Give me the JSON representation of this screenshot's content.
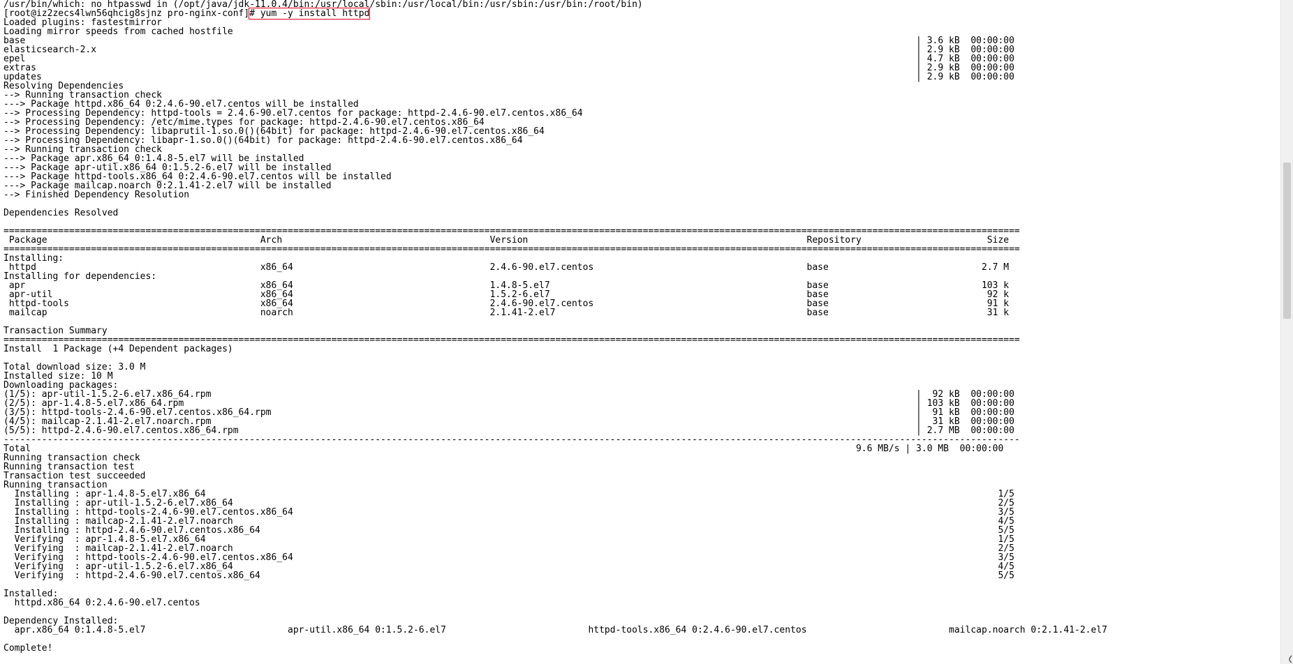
{
  "terminal": {
    "lines": [
      "/usr/bin/which: no htpasswd in (/opt/java/jdk-11.0.4/bin:/usr/local/sbin:/usr/local/bin:/usr/sbin:/usr/bin:/root/bin)",
      "[root@iz2zecs4lwn56qhcig8sjnz pro-nginx-conf]# yum -y install httpd",
      "Loaded plugins: fastestmirror",
      "Loading mirror speeds from cached hostfile",
      "base                                                                                                                                                                   | 3.6 kB  00:00:00",
      "elasticsearch-2.x                                                                                                                                                      | 2.9 kB  00:00:00",
      "epel                                                                                                                                                                   | 4.7 kB  00:00:00",
      "extras                                                                                                                                                                 | 2.9 kB  00:00:00",
      "updates                                                                                                                                                                | 2.9 kB  00:00:00",
      "Resolving Dependencies",
      "--> Running transaction check",
      "---> Package httpd.x86_64 0:2.4.6-90.el7.centos will be installed",
      "--> Processing Dependency: httpd-tools = 2.4.6-90.el7.centos for package: httpd-2.4.6-90.el7.centos.x86_64",
      "--> Processing Dependency: /etc/mime.types for package: httpd-2.4.6-90.el7.centos.x86_64",
      "--> Processing Dependency: libaprutil-1.so.0()(64bit) for package: httpd-2.4.6-90.el7.centos.x86_64",
      "--> Processing Dependency: libapr-1.so.0()(64bit) for package: httpd-2.4.6-90.el7.centos.x86_64",
      "--> Running transaction check",
      "---> Package apr.x86_64 0:1.4.8-5.el7 will be installed",
      "---> Package apr-util.x86_64 0:1.5.2-6.el7 will be installed",
      "---> Package httpd-tools.x86_64 0:2.4.6-90.el7.centos will be installed",
      "---> Package mailcap.noarch 0:2.1.41-2.el7 will be installed",
      "--> Finished Dependency Resolution",
      "",
      "Dependencies Resolved",
      "",
      "==========================================================================================================================================================================================",
      " Package                                       Arch                                      Version                                                   Repository                       Size",
      "==========================================================================================================================================================================================",
      "Installing:",
      " httpd                                         x86_64                                    2.4.6-90.el7.centos                                       base                            2.7 M",
      "Installing for dependencies:",
      " apr                                           x86_64                                    1.4.8-5.el7                                               base                            103 k",
      " apr-util                                      x86_64                                    1.5.2-6.el7                                               base                             92 k",
      " httpd-tools                                   x86_64                                    2.4.6-90.el7.centos                                       base                             91 k",
      " mailcap                                       noarch                                    2.1.41-2.el7                                              base                             31 k",
      "",
      "Transaction Summary",
      "==========================================================================================================================================================================================",
      "Install  1 Package (+4 Dependent packages)",
      "",
      "Total download size: 3.0 M",
      "Installed size: 10 M",
      "Downloading packages:",
      "(1/5): apr-util-1.5.2-6.el7.x86_64.rpm                                                                                                                                 |  92 kB  00:00:00",
      "(2/5): apr-1.4.8-5.el7.x86_64.rpm                                                                                                                                      | 103 kB  00:00:00",
      "(3/5): httpd-tools-2.4.6-90.el7.centos.x86_64.rpm                                                                                                                      |  91 kB  00:00:00",
      "(4/5): mailcap-2.1.41-2.el7.noarch.rpm                                                                                                                                 |  31 kB  00:00:00",
      "(5/5): httpd-2.4.6-90.el7.centos.x86_64.rpm                                                                                                                            | 2.7 MB  00:00:00",
      "------------------------------------------------------------------------------------------------------------------------------------------------------------------------------------------",
      "Total                                                                                                                                                       9.6 MB/s | 3.0 MB  00:00:00",
      "Running transaction check",
      "Running transaction test",
      "Transaction test succeeded",
      "Running transaction",
      "  Installing : apr-1.4.8-5.el7.x86_64                                                                                                                                                 1/5",
      "  Installing : apr-util-1.5.2-6.el7.x86_64                                                                                                                                            2/5",
      "  Installing : httpd-tools-2.4.6-90.el7.centos.x86_64                                                                                                                                 3/5",
      "  Installing : mailcap-2.1.41-2.el7.noarch                                                                                                                                            4/5",
      "  Installing : httpd-2.4.6-90.el7.centos.x86_64                                                                                                                                       5/5",
      "  Verifying  : apr-1.4.8-5.el7.x86_64                                                                                                                                                 1/5",
      "  Verifying  : mailcap-2.1.41-2.el7.noarch                                                                                                                                            2/5",
      "  Verifying  : httpd-tools-2.4.6-90.el7.centos.x86_64                                                                                                                                 3/5",
      "  Verifying  : apr-util-1.5.2-6.el7.x86_64                                                                                                                                            4/5",
      "  Verifying  : httpd-2.4.6-90.el7.centos.x86_64                                                                                                                                       5/5",
      "",
      "Installed:",
      "  httpd.x86_64 0:2.4.6-90.el7.centos",
      "",
      "Dependency Installed:",
      "  apr.x86_64 0:1.4.8-5.el7                          apr-util.x86_64 0:1.5.2-6.el7                          httpd-tools.x86_64 0:2.4.6-90.el7.centos                          mailcap.noarch 0:2.1.41-2.el7",
      "",
      "Complete!"
    ],
    "highlighted_command": "yum -y install httpd"
  },
  "colors": {
    "background": "#ffffff",
    "text": "#000000",
    "highlight_border": "#e0001a",
    "scrollbar_track": "#f0f0f0",
    "scrollbar_thumb": "#cdcdcd"
  },
  "scrollbar": {
    "thumb_start_fraction": 0.245,
    "thumb_length_fraction": 0.235
  }
}
